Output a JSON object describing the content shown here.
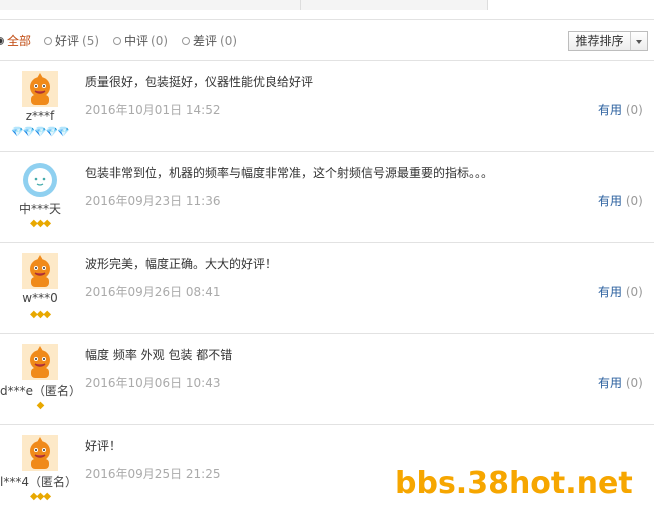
{
  "filters": [
    {
      "label": "全部",
      "count": "",
      "active": true
    },
    {
      "label": "好评",
      "count": "(5)",
      "active": false
    },
    {
      "label": "中评",
      "count": "(0)",
      "active": false
    },
    {
      "label": "差评",
      "count": "(0)",
      "active": false
    }
  ],
  "sort": {
    "label": "推荐排序"
  },
  "reviews": [
    {
      "user": "z***f",
      "avatar": "orange-mascot",
      "badges": "💎💎💎💎💎",
      "badge_color": "red",
      "content": "质量很好，包装挺好，仪器性能优良给好评",
      "date": "2016年10月01日 14:52",
      "useful_label": "有用",
      "useful_count": "(0)"
    },
    {
      "user": "中***天",
      "avatar": "blue-cloud",
      "badges": "◆◆◆",
      "badge_color": "gold",
      "content": "包装非常到位，机器的频率与幅度非常准，这个射频信号源最重要的指标。。。",
      "date": "2016年09月23日 11:36",
      "useful_label": "有用",
      "useful_count": "(0)"
    },
    {
      "user": "w***0",
      "avatar": "orange-mascot",
      "badges": "◆◆◆",
      "badge_color": "gold",
      "content": "波形完美，幅度正确。大大的好评！",
      "date": "2016年09月26日 08:41",
      "useful_label": "有用",
      "useful_count": "(0)"
    },
    {
      "user": "d***e（匿名）",
      "avatar": "orange-mascot",
      "badges": "◆",
      "badge_color": "gold",
      "content": "幅度 频率 外观 包装 都不错",
      "date": "2016年10月06日 10:43",
      "useful_label": "有用",
      "useful_count": "(0)"
    },
    {
      "user": "l***4（匿名）",
      "avatar": "orange-mascot",
      "badges": "◆◆◆",
      "badge_color": "gold",
      "content": "好评！",
      "date": "2016年09月25日 21:25",
      "useful_label": "",
      "useful_count": ""
    }
  ],
  "watermark": "bbs.38hot.net",
  "colors": {
    "accent_orange": "#c04a10",
    "link_blue": "#2a5f9e",
    "badge_red": "#e0303a",
    "badge_gold": "#e8a800",
    "watermark": "#f6a600"
  }
}
